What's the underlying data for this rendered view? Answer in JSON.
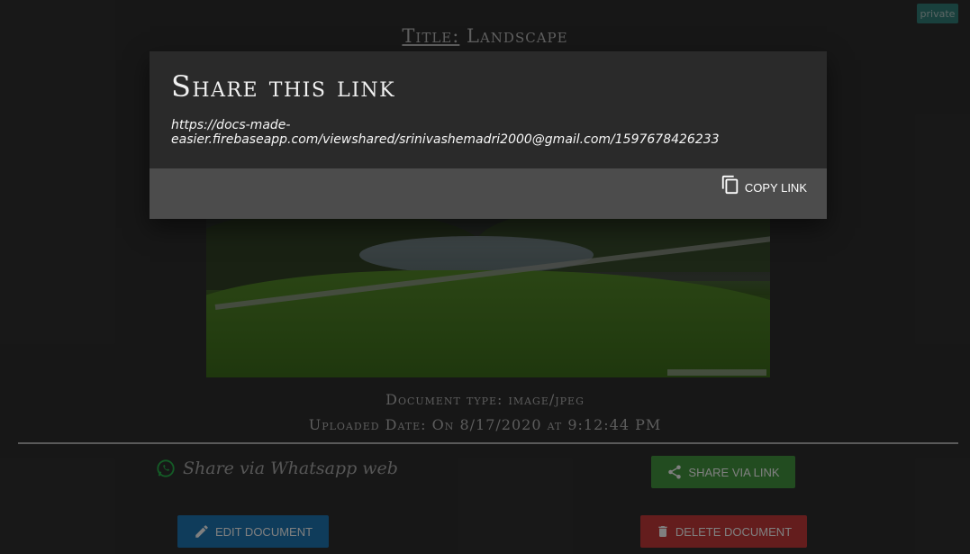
{
  "badge": {
    "label": "private"
  },
  "document": {
    "title_key": "Title:",
    "title_value": "Landscape",
    "type_line": "Document type: image/jpeg",
    "date_line": "Uploaded Date: On 8/17/2020 at 9:12:44 PM"
  },
  "share": {
    "whatsapp_label": "Share via Whatsapp web",
    "link_button": "share via link"
  },
  "actions": {
    "edit": "edit document",
    "delete": "delete document"
  },
  "modal": {
    "heading": "Share this link",
    "url": "https://docs-made-easier.firebaseapp.com/viewshared/srinivashemadri2000@gmail.com/1597678426233",
    "copy_label": "copy link"
  },
  "colors": {
    "share_button": "#3f8a3b",
    "edit_button": "#1d6ea6",
    "delete_button": "#b73635",
    "badge": "#2f8f86"
  },
  "icons": {
    "whatsapp": "whatsapp-icon",
    "share": "share-icon",
    "edit": "pencil-icon",
    "delete": "trash-icon",
    "copy": "copy-icon"
  }
}
